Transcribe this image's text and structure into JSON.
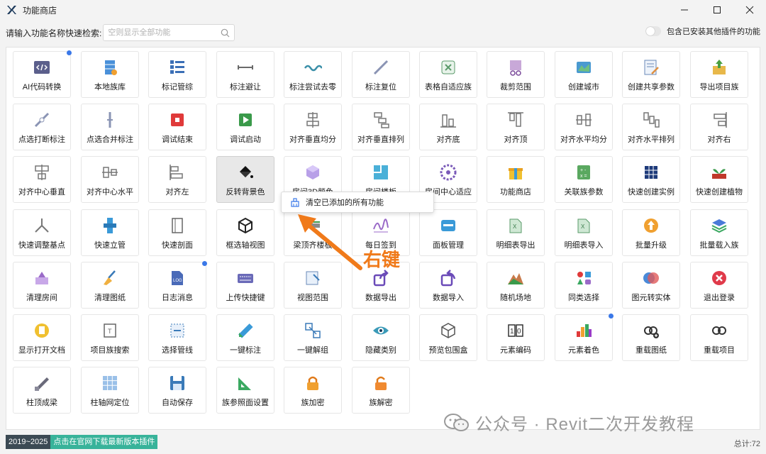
{
  "window": {
    "title": "功能商店"
  },
  "search": {
    "label": "请输入功能名称快速检索:",
    "placeholder": "空则显示全部功能",
    "value": ""
  },
  "toggle": {
    "label": "包含已安装其他插件的功能",
    "checked": false
  },
  "tiles": [
    {
      "label": "AI代码转换",
      "icon": "code-icon"
    },
    {
      "label": "本地族库",
      "icon": "database-icon"
    },
    {
      "label": "标记管综",
      "icon": "list-icon"
    },
    {
      "label": "标注避让",
      "icon": "dimension-icon"
    },
    {
      "label": "标注尝试去零",
      "icon": "wave-icon"
    },
    {
      "label": "标注复位",
      "icon": "diagonal-line-icon"
    },
    {
      "label": "表格自适应族",
      "icon": "table-fit-icon"
    },
    {
      "label": "裁剪范围",
      "icon": "crop-icon"
    },
    {
      "label": "创建城市",
      "icon": "map-icon"
    },
    {
      "label": "创建共享参数",
      "icon": "form-edit-icon"
    },
    {
      "label": "导出项目族",
      "icon": "export-icon"
    },
    {
      "label": "点选打断标注",
      "icon": "break-dimension-icon"
    },
    {
      "label": "点选合并标注",
      "icon": "merge-dimension-icon"
    },
    {
      "label": "调试结束",
      "icon": "stop-icon"
    },
    {
      "label": "调试启动",
      "icon": "play-icon"
    },
    {
      "label": "对齐垂直均分",
      "icon": "align-vdistribute-icon"
    },
    {
      "label": "对齐垂直排列",
      "icon": "align-varrange-icon"
    },
    {
      "label": "对齐底",
      "icon": "align-bottom-icon"
    },
    {
      "label": "对齐顶",
      "icon": "align-top-icon"
    },
    {
      "label": "对齐水平均分",
      "icon": "align-hdistribute-icon"
    },
    {
      "label": "对齐水平排列",
      "icon": "align-harrange-icon"
    },
    {
      "label": "对齐右",
      "icon": "align-right-icon"
    },
    {
      "label": "对齐中心垂直",
      "icon": "align-vcenter-icon"
    },
    {
      "label": "对齐中心水平",
      "icon": "align-hcenter-icon"
    },
    {
      "label": "对齐左",
      "icon": "align-left-icon"
    },
    {
      "label": "反转背景色",
      "icon": "paint-bucket-icon"
    },
    {
      "label": "房间3D颜色",
      "icon": "cube-color-icon"
    },
    {
      "label": "房间楼板",
      "icon": "room-floor-icon"
    },
    {
      "label": "房间中心适应",
      "icon": "room-center-icon"
    },
    {
      "label": "功能商店",
      "icon": "gift-icon"
    },
    {
      "label": "关联族参数",
      "icon": "calculator-icon"
    },
    {
      "label": "快速创建实例",
      "icon": "grid-icon"
    },
    {
      "label": "快速创建植物",
      "icon": "plant-icon"
    },
    {
      "label": "快速调整基点",
      "icon": "base-point-icon"
    },
    {
      "label": "快速立管",
      "icon": "pipe-icon"
    },
    {
      "label": "快速剖面",
      "icon": "section-icon"
    },
    {
      "label": "框选轴视图",
      "icon": "box-3d-icon"
    },
    {
      "label": "梁顶齐楼板",
      "icon": "beam-align-icon"
    },
    {
      "label": "每日签到",
      "icon": "signature-icon"
    },
    {
      "label": "面板管理",
      "icon": "panel-icon"
    },
    {
      "label": "明细表导出",
      "icon": "excel-export-icon"
    },
    {
      "label": "明细表导入",
      "icon": "excel-import-icon"
    },
    {
      "label": "批量升级",
      "icon": "upgrade-icon"
    },
    {
      "label": "批量载入族",
      "icon": "layers-icon"
    },
    {
      "label": "清理房间",
      "icon": "clean-room-icon"
    },
    {
      "label": "清理图纸",
      "icon": "broom-icon"
    },
    {
      "label": "日志消息",
      "icon": "log-icon"
    },
    {
      "label": "上传快捷键",
      "icon": "keyboard-icon"
    },
    {
      "label": "视图范围",
      "icon": "view-range-icon"
    },
    {
      "label": "数据导出",
      "icon": "share-export-icon"
    },
    {
      "label": "数据导入",
      "icon": "share-import-icon"
    },
    {
      "label": "随机场地",
      "icon": "mountain-icon"
    },
    {
      "label": "同类选择",
      "icon": "shapes-icon"
    },
    {
      "label": "图元转实体",
      "icon": "spheres-icon"
    },
    {
      "label": "退出登录",
      "icon": "logout-icon"
    },
    {
      "label": "显示打开文档",
      "icon": "documents-icon"
    },
    {
      "label": "项目族搜索",
      "icon": "family-search-icon"
    },
    {
      "label": "选择管线",
      "icon": "select-pipe-icon"
    },
    {
      "label": "一键标注",
      "icon": "ruler-icon"
    },
    {
      "label": "一键解组",
      "icon": "ungroup-icon"
    },
    {
      "label": "隐藏类别",
      "icon": "eye-icon"
    },
    {
      "label": "预览包围盒",
      "icon": "bounding-box-icon"
    },
    {
      "label": "元素编码",
      "icon": "code-number-icon"
    },
    {
      "label": "元素着色",
      "icon": "palette-icon"
    },
    {
      "label": "重载图纸",
      "icon": "link-add-icon"
    },
    {
      "label": "重载项目",
      "icon": "link-icon"
    },
    {
      "label": "柱顶成梁",
      "icon": "beam-icon"
    },
    {
      "label": "柱轴网定位",
      "icon": "column-grid-icon"
    },
    {
      "label": "自动保存",
      "icon": "save-icon"
    },
    {
      "label": "族参照面设置",
      "icon": "set-square-icon"
    },
    {
      "label": "族加密",
      "icon": "lock-icon"
    },
    {
      "label": "族解密",
      "icon": "unlock-icon"
    }
  ],
  "context_menu": {
    "item_label": "清空已添加的所有功能",
    "icon": "clear-icon"
  },
  "annotation": {
    "text": "右键"
  },
  "status": {
    "years": "2019~2025",
    "download_link": "点击在官网下载最新版本插件",
    "total": "总计:72"
  },
  "watermark": {
    "text": "公众号 · Revit二次开发教程"
  },
  "colors": {
    "accent_blue": "#3a78e8",
    "orange_annotation": "#f07a1a",
    "badge_dark": "#3c4a54",
    "badge_teal": "#38b39a"
  }
}
